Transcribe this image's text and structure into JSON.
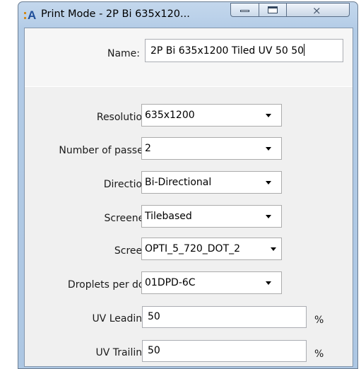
{
  "window": {
    "title": "Print Mode - 2P Bi 635x120...",
    "app_icon": "app-logo-icon",
    "controls": [
      "minimize-icon",
      "maximize-icon",
      "close-icon"
    ],
    "close_glyph": "⨯"
  },
  "name_field": {
    "label": "Name:",
    "value": "2P Bi 635x1200 Tiled UV 50 50"
  },
  "settings": {
    "resolution": {
      "label": "Resolution",
      "value": "635x1200"
    },
    "passes": {
      "label": "Number of passes",
      "value": "2"
    },
    "direction": {
      "label": "Direction",
      "value": "Bi-Directional"
    },
    "screener": {
      "label": "Screener",
      "value": "Tilebased"
    },
    "screen": {
      "label": "Screen",
      "value": "OPTI_5_720_DOT_2"
    },
    "droplets": {
      "label": "Droplets per dot",
      "value": "01DPD-6C"
    },
    "uv_leading": {
      "label": "UV Leading",
      "value": "50",
      "unit": "%"
    },
    "uv_trailing": {
      "label": "UV Trailing",
      "value": "50",
      "unit": "%"
    }
  }
}
